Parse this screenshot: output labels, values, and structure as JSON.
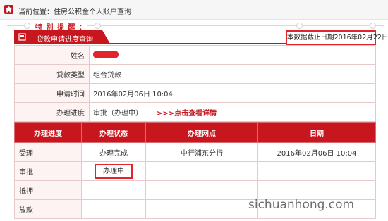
{
  "breadcrumb": "当前位置：住房公积金个人账户查询",
  "notice": {
    "title": "特 别 提 醒 ："
  },
  "tab": {
    "label": "贷款申请进度查询"
  },
  "deadline": "本数据截止日期2016年02月22日",
  "info": {
    "rows": [
      {
        "label": "姓名",
        "value": ""
      },
      {
        "label": "贷款类型",
        "value": "组合贷款"
      },
      {
        "label": "申请时间",
        "value": "2016年02月06日 10:04"
      },
      {
        "label": "办理进度",
        "value": "审批（办理中）"
      }
    ],
    "detail_link": ">>>点击查看详情"
  },
  "status_table": {
    "headers": [
      "办理进度",
      "办理状态",
      "办理网点",
      "日期"
    ],
    "rows": [
      [
        "受理",
        "办理完成",
        "中行浦东分行",
        "2016年02月06日 10:04"
      ],
      [
        "审批",
        "办理中",
        "",
        ""
      ],
      [
        "抵押",
        "",
        "",
        ""
      ],
      [
        "放款",
        "",
        "",
        ""
      ]
    ]
  },
  "watermark": "sichuanhong.com",
  "colors": {
    "accent": "#c8161e",
    "highlight_border": "#e0262c",
    "label_bg": "#fdf3f3"
  },
  "icons": {
    "home": "home-icon",
    "tab": "document-icon"
  }
}
